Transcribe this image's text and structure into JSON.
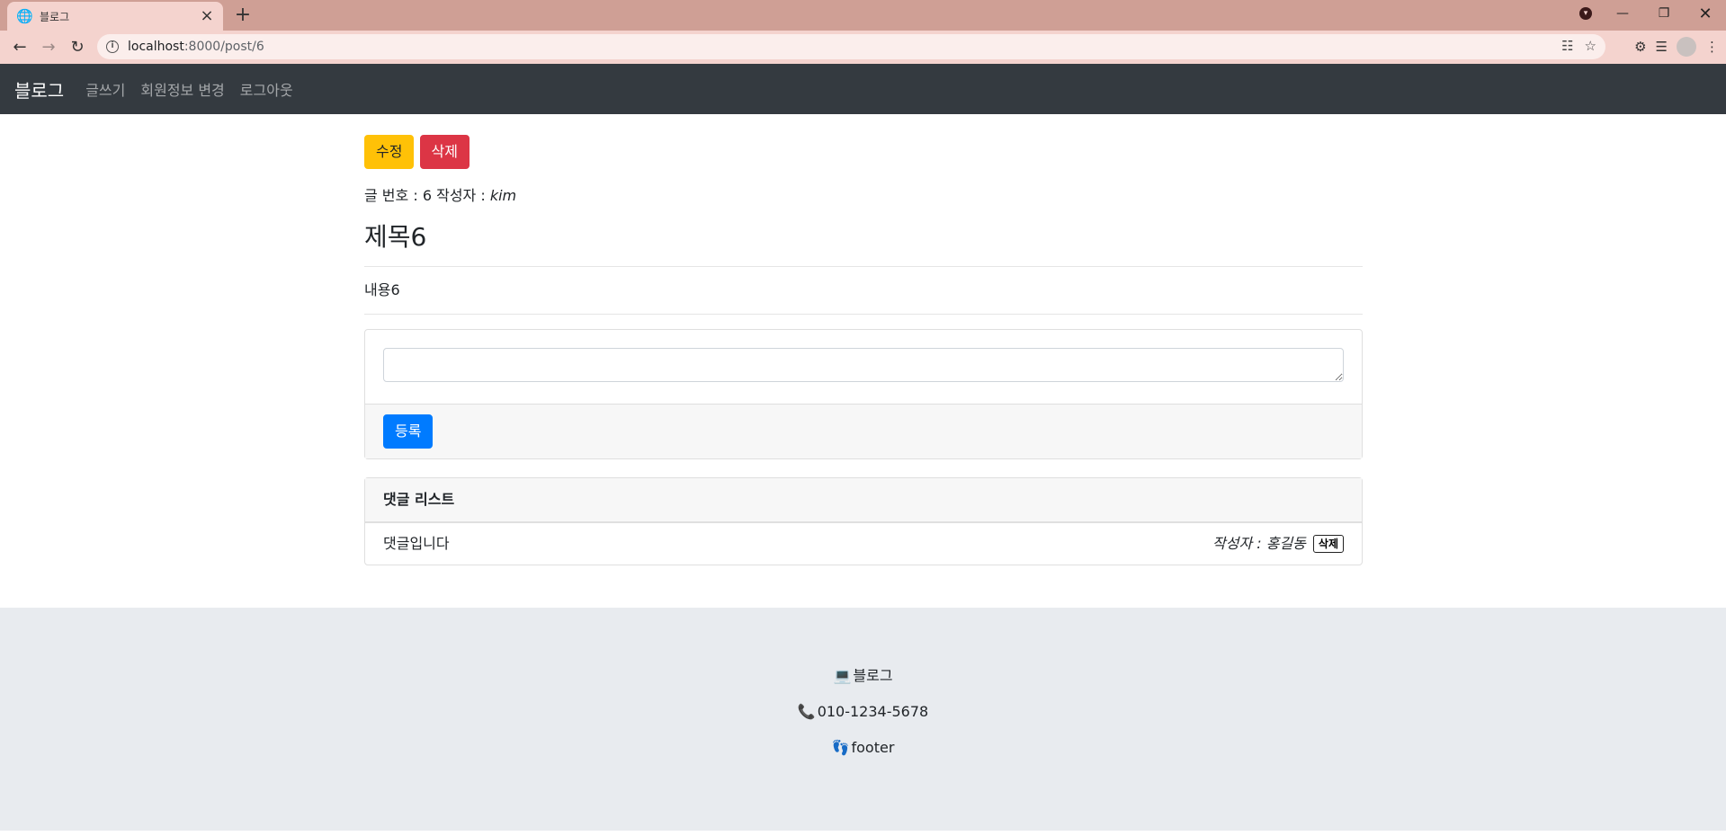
{
  "browser": {
    "tab_title": "블로그",
    "url_host": "localhost",
    "url_path": ":8000/post/6"
  },
  "navbar": {
    "brand": "블로그",
    "links": [
      "글쓰기",
      "회원정보 변경",
      "로그아웃"
    ]
  },
  "post": {
    "edit_label": "수정",
    "delete_label": "삭제",
    "number_label": "글 번호 :",
    "number": "6",
    "author_label": "작성자 :",
    "author": "kim",
    "title": "제목6",
    "content": "내용6"
  },
  "reply_form": {
    "placeholder": "",
    "submit_label": "등록"
  },
  "reply_list": {
    "header": "댓글 리스트",
    "items": [
      {
        "text": "댓글입니다",
        "author": "작성자 : 홍길동",
        "delete_label": "삭제"
      }
    ]
  },
  "footer": {
    "site": "블로그",
    "phone": "010-1234-5678",
    "text": "footer"
  },
  "icons": {
    "footer_site": "laptop-icon",
    "footer_phone": "phone-icon",
    "footer_text": "footprint-icon"
  }
}
